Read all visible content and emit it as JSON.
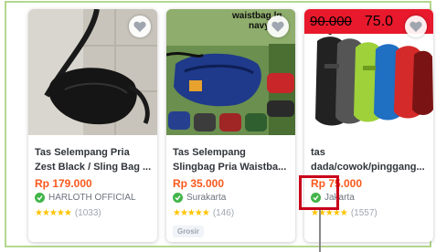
{
  "products": [
    {
      "name_lines": [
        "Tas Selempang Pria",
        "Zest Black / Sling Bag ..."
      ],
      "price": "Rp 179.000",
      "shop": "HARLOTH OFFICIAL",
      "stars": "★★★★★",
      "reviews": "(1033)"
    },
    {
      "name_lines": [
        "Tas Selempang",
        "Slingbag Pria Waistba..."
      ],
      "price": "Rp 35.000",
      "shop": "Surakarta",
      "stars": "★★★★★",
      "reviews": "(146)",
      "tag": "Grosir",
      "image_text": {
        "line1": "waistbag lg",
        "line2": "navy"
      }
    },
    {
      "name_lines": [
        "tas",
        "dada/cowok/pinggang..."
      ],
      "price": "Rp 75.000",
      "shop": "Jakarta",
      "stars": "★★★★★",
      "reviews": "(1557)",
      "promo": {
        "old_price": "90.000",
        "new_price": "75.0"
      }
    }
  ],
  "colors": {
    "price": "#fa591d",
    "highlight": "#c8001a",
    "frame": "#b3d88e",
    "badge": "#42b549"
  },
  "icons": [
    "heart-icon",
    "shop-badge-icon",
    "star-icon"
  ]
}
